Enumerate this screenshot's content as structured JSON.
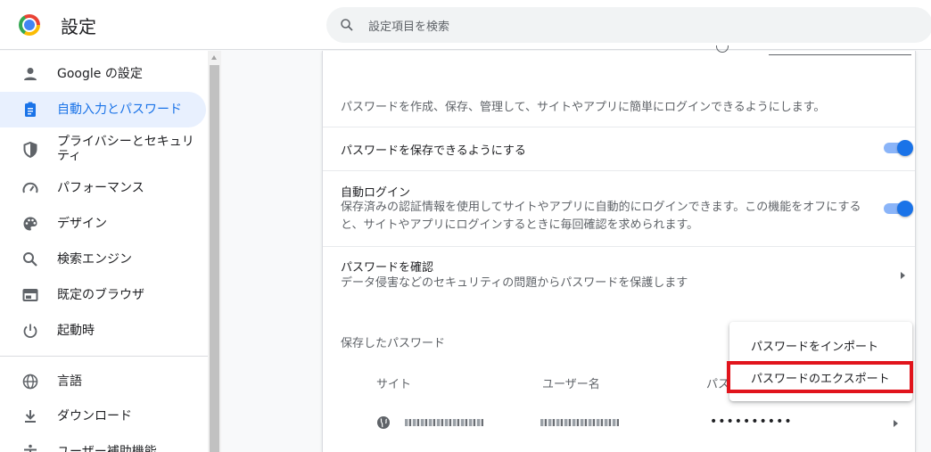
{
  "header": {
    "title": "設定",
    "search_placeholder": "設定項目を検索"
  },
  "sidebar": {
    "items": [
      {
        "label": "Google の設定",
        "icon": "person-icon",
        "active": false
      },
      {
        "label": "自動入力とパスワード",
        "icon": "clipboard-icon",
        "active": true
      },
      {
        "label": "プライバシーとセキュリティ",
        "icon": "shield-icon",
        "active": false
      },
      {
        "label": "パフォーマンス",
        "icon": "speedometer-icon",
        "active": false
      },
      {
        "label": "デザイン",
        "icon": "palette-icon",
        "active": false
      },
      {
        "label": "検索エンジン",
        "icon": "search-icon",
        "active": false
      },
      {
        "label": "既定のブラウザ",
        "icon": "browser-icon",
        "active": false
      },
      {
        "label": "起動時",
        "icon": "power-icon",
        "active": false
      },
      {
        "label": "言語",
        "icon": "globe-icon",
        "active": false
      },
      {
        "label": "ダウンロード",
        "icon": "download-icon",
        "active": false
      },
      {
        "label": "ユーザー補助機能",
        "icon": "accessibility-icon",
        "active": false
      }
    ]
  },
  "main": {
    "description": "パスワードを作成、保存、管理して、サイトやアプリに簡単にログインできるようにします。",
    "offer_save": {
      "label": "パスワードを保存できるようにする",
      "enabled": true
    },
    "auto_signin": {
      "label": "自動ログイン",
      "description": "保存済みの認証情報を使用してサイトやアプリに自動的にログインできます。この機能をオフにすると、サイトやアプリにログインするときに毎回確認を求められます。",
      "enabled": true
    },
    "check_passwords": {
      "label": "パスワードを確認",
      "description": "データ侵害などのセキュリティの問題からパスワードを保護します"
    },
    "saved_passwords": {
      "title": "保存したパスワード",
      "columns": [
        "サイト",
        "ユーザー名",
        "パス"
      ],
      "rows": [
        {
          "password": "••••••••••"
        }
      ]
    }
  },
  "menu": {
    "items": [
      "パスワードをインポート",
      "パスワードのエクスポート"
    ],
    "highlighted": "パスワードのエクスポート"
  },
  "colors": {
    "accent": "#1a73e8",
    "active_bg": "#e8f0fe",
    "highlight_border": "#e1141c"
  }
}
